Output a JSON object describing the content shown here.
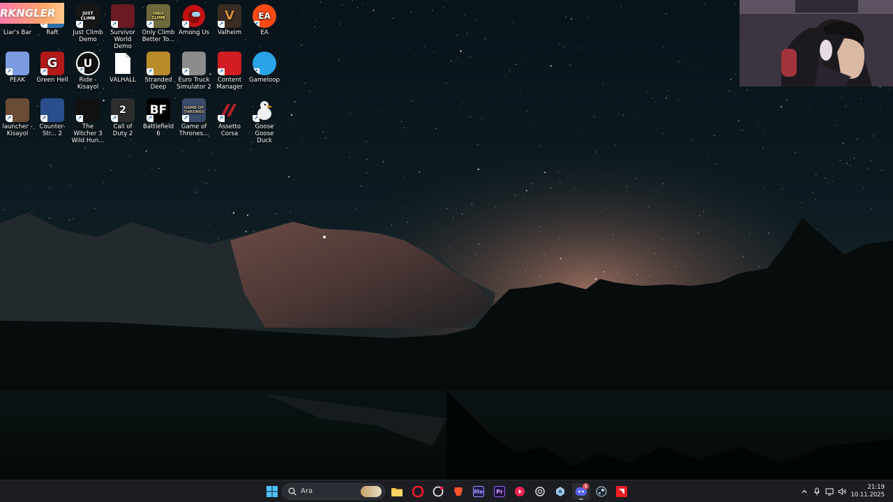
{
  "banner_text": "RKNGLER",
  "desktop_icons": [
    {
      "label": "Liar's Bar",
      "icon": "liars-bar-icon"
    },
    {
      "label": "Raft",
      "icon": "raft-icon"
    },
    {
      "label": "Just Climb Demo",
      "icon": "just-climb-icon",
      "art": "JUST CLIMB"
    },
    {
      "label": "Survivor World Demo",
      "icon": "survivor-world-icon"
    },
    {
      "label": "Only Climb Better To...",
      "icon": "only-climb-icon",
      "art": "ONLY CLIMB"
    },
    {
      "label": "Among Us",
      "icon": "among-us-icon"
    },
    {
      "label": "Valheim",
      "icon": "valheim-icon",
      "art": "V"
    },
    {
      "label": "EA",
      "icon": "ea-icon",
      "art": "EA"
    },
    {
      "label": "PEAK",
      "icon": "peak-icon"
    },
    {
      "label": "Green Hell",
      "icon": "green-hell-icon",
      "art": "G"
    },
    {
      "label": "Ride - Kisayol",
      "icon": "unreal-engine-icon",
      "art": "U"
    },
    {
      "label": "VALHALL",
      "icon": "file-icon"
    },
    {
      "label": "Stranded Deep",
      "icon": "stranded-deep-icon"
    },
    {
      "label": "Euro Truck Simulator 2",
      "icon": "euro-truck-icon"
    },
    {
      "label": "Content Manager",
      "icon": "content-manager-icon"
    },
    {
      "label": "Gameloop",
      "icon": "gameloop-icon"
    },
    {
      "label": "launcher - Kisayol",
      "icon": "launcher-icon"
    },
    {
      "label": "Counter-Str... 2",
      "icon": "counter-strike-icon"
    },
    {
      "label": "The Witcher 3 Wild Hun...",
      "icon": "witcher-icon"
    },
    {
      "label": "Call of Duty 2",
      "icon": "call-of-duty-icon",
      "art": "2"
    },
    {
      "label": "Battlefield 6",
      "icon": "battlefield-icon",
      "art": "BF"
    },
    {
      "label": "Game of Thrones...",
      "icon": "game-of-thrones-icon",
      "art": "GAME OF THRONES"
    },
    {
      "label": "Assetto Corsa",
      "icon": "assetto-corsa-icon"
    },
    {
      "label": "Goose Goose Duck",
      "icon": "goose-goose-duck-icon"
    }
  ],
  "taskbar": {
    "search_placeholder": "Ara",
    "apps": [
      {
        "icon": "file-explorer-icon"
      },
      {
        "icon": "opera-icon"
      },
      {
        "icon": "opera-gx-icon"
      },
      {
        "icon": "brave-icon"
      },
      {
        "icon": "media-encoder-icon",
        "text": "Me"
      },
      {
        "icon": "premiere-pro-icon",
        "text": "Pr"
      },
      {
        "icon": "media-player-icon"
      },
      {
        "icon": "chatgpt-icon"
      },
      {
        "icon": "settings-app-icon"
      },
      {
        "icon": "discord-icon",
        "badge": "1"
      },
      {
        "icon": "steam-icon"
      },
      {
        "icon": "amd-icon"
      }
    ],
    "clock_time": "21:19",
    "clock_date": "10.11.2025"
  },
  "colors": {
    "taskbar_bg": "#1b1d22",
    "sky_top": "#0a1518",
    "glow": "#b9806c"
  }
}
